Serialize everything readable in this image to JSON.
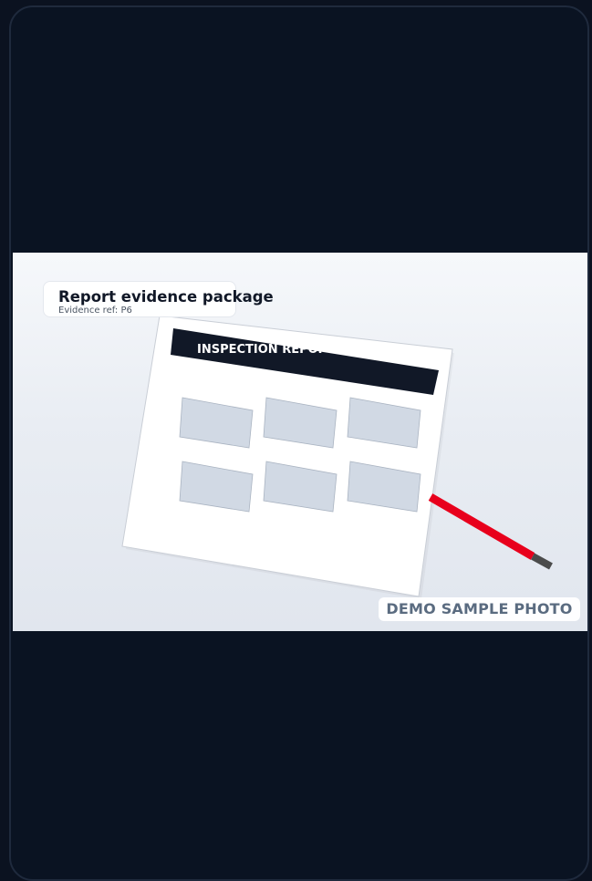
{
  "photo": {
    "title": "Report evidence package",
    "evidence_ref": "Evidence ref: P6",
    "document_header": "INSPECTION REPORT",
    "watermark": "DEMO SAMPLE PHOTO"
  },
  "colors": {
    "background": "#0b1220",
    "document_header_bar": "#111827",
    "photo_placeholder": "#d1d9e4",
    "pen_body": "#e8001c",
    "pen_tip": "#4b4b4b",
    "watermark_text": "#5a6b80"
  }
}
